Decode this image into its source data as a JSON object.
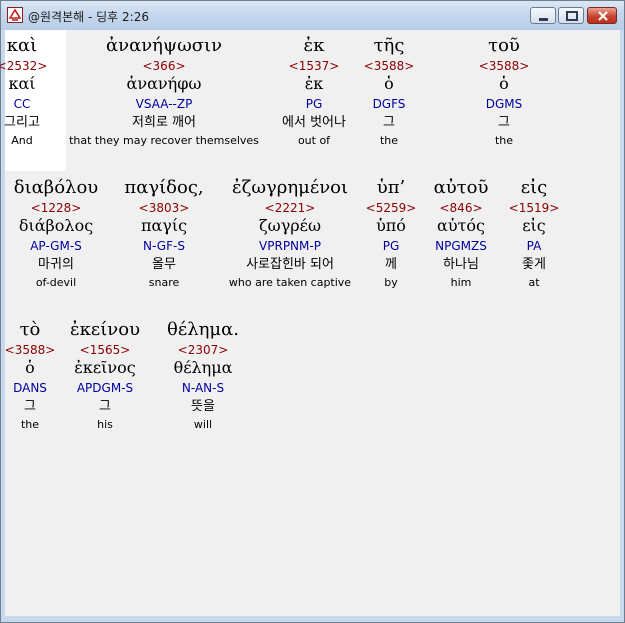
{
  "window": {
    "title": "@원격본해 - 딩후 2:26"
  },
  "rows": [
    [
      {
        "greek": "καὶ",
        "strong": "<2532>",
        "lemma": "καί",
        "parse": "CC",
        "korean": "그리고",
        "english": "And"
      },
      {
        "greek": "ἀνανήψωσιν",
        "strong": "<366>",
        "lemma": "ἀνανήφω",
        "parse": "VSAA--ZP",
        "korean": "저희로 깨어",
        "english": "that they may recover themselves"
      },
      {
        "greek": "ἐκ",
        "strong": "<1537>",
        "lemma": "ἐκ",
        "parse": "PG",
        "korean": "에서 벗어나",
        "english": "out of"
      },
      {
        "greek": "τῆς",
        "strong": "<3588>",
        "lemma": "ὁ",
        "parse": "DGFS",
        "korean": "그",
        "english": "the"
      },
      {
        "greek": "τοῦ",
        "strong": "<3588>",
        "lemma": "ὁ",
        "parse": "DGMS",
        "korean": "그",
        "english": "the"
      }
    ],
    [
      {
        "greek": "διαβόλου",
        "strong": "<1228>",
        "lemma": "διάβολος",
        "parse": "AP-GM-S",
        "korean": "마귀의",
        "english": "of-devil"
      },
      {
        "greek": "παγίδος,",
        "strong": "<3803>",
        "lemma": "παγίς",
        "parse": "N-GF-S",
        "korean": "올무",
        "english": "snare"
      },
      {
        "greek": "ἐζωγρημένοι",
        "strong": "<2221>",
        "lemma": "ζωγρέω",
        "parse": "VPRPNM-P",
        "korean": "사로잡힌바 되어",
        "english": "who are taken captive"
      },
      {
        "greek": "ὑπ’",
        "strong": "<5259>",
        "lemma": "ὑπό",
        "parse": "PG",
        "korean": "께",
        "english": "by"
      },
      {
        "greek": "αὐτοῦ",
        "strong": "<846>",
        "lemma": "αὐτός",
        "parse": "NPGMZS",
        "korean": "하나님",
        "english": "him"
      },
      {
        "greek": "εἰς",
        "strong": "<1519>",
        "lemma": "εἰς",
        "parse": "PA",
        "korean": "좇게",
        "english": "at"
      }
    ],
    [
      {
        "greek": "τὸ",
        "strong": "<3588>",
        "lemma": "ὁ",
        "parse": "DANS",
        "korean": "그",
        "english": "the"
      },
      {
        "greek": "ἐκείνου",
        "strong": "<1565>",
        "lemma": "ἐκεῖνος",
        "parse": "APDGM-S",
        "korean": "그",
        "english": "his"
      },
      {
        "greek": "θέλημα.",
        "strong": "<2307>",
        "lemma": "θέλημα",
        "parse": "N-AN-S",
        "korean": "뜻을",
        "english": "will"
      }
    ]
  ]
}
